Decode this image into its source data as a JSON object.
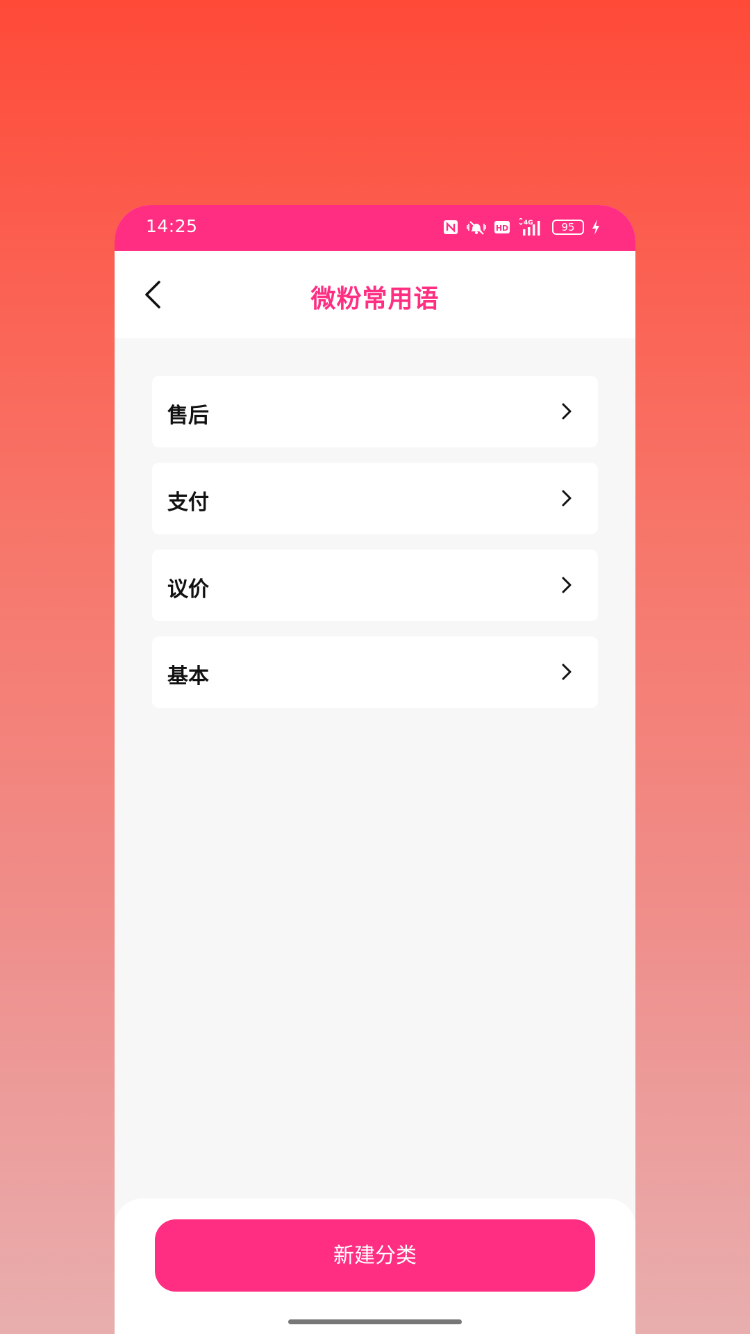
{
  "status_bar": {
    "time": "14:25",
    "battery_level": "95",
    "network_label": "4G",
    "hd_label": "HD",
    "icons": [
      "nfc-icon",
      "vibrate-mute-icon",
      "hd-icon",
      "signal-4g-icon",
      "battery-icon",
      "charging-icon"
    ]
  },
  "header": {
    "title": "微粉常用语",
    "back_icon": "chevron-left-icon"
  },
  "categories": [
    {
      "label": "售后"
    },
    {
      "label": "支付"
    },
    {
      "label": "议价"
    },
    {
      "label": "基本"
    }
  ],
  "footer": {
    "new_category_label": "新建分类"
  },
  "colors": {
    "accent": "#ff2e82",
    "background_top": "#ff4a38",
    "background_bottom": "#e8aeae",
    "page_bg": "#f7f7f7"
  }
}
